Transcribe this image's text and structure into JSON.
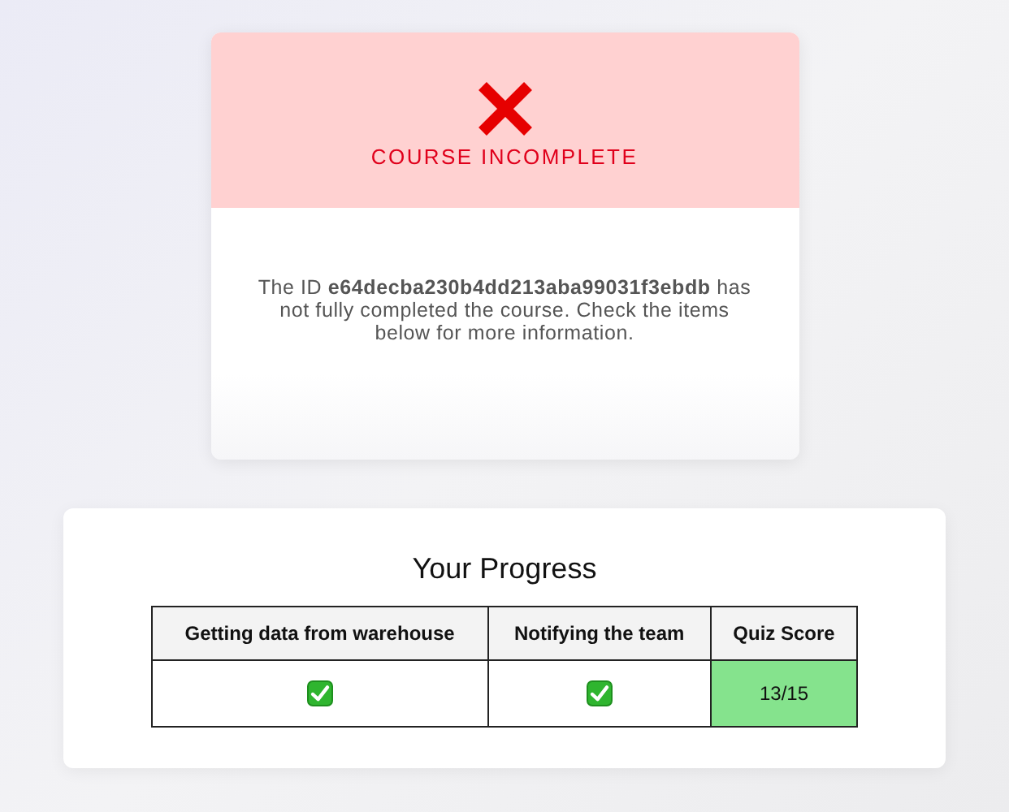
{
  "status_card": {
    "passed": false,
    "title": "COURSE INCOMPLETE",
    "message": "The ID **e64decba230b4dd213aba99031f3ebdb** has not fully completed the course. Check the items below for more information."
  },
  "progress": {
    "title": "Your Progress",
    "columns": [
      {
        "label": "Getting data from warehouse",
        "kind": "check",
        "checked": true
      },
      {
        "label": "Notifying the team",
        "kind": "check",
        "checked": true
      },
      {
        "label": "Quiz Score",
        "kind": "score",
        "value": "13/15",
        "passed": true
      }
    ]
  }
}
